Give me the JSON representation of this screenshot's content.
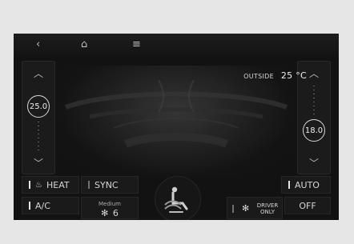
{
  "topbar": {
    "back_icon": "chevron-left-icon",
    "home_icon": "home-icon",
    "menu_icon": "menu-icon"
  },
  "left_zone": {
    "temperature": "25.0"
  },
  "right_zone": {
    "temperature": "18.0"
  },
  "outside": {
    "label": "OUTSIDE",
    "value": "25 °C"
  },
  "buttons": {
    "heat": "HEAT",
    "sync": "SYNC",
    "auto": "AUTO",
    "ac": "A/C",
    "fan_level_label": "Medium",
    "fan_level_value": "6",
    "driver_only_line1": "DRIVER",
    "driver_only_line2": "ONLY",
    "off": "OFF"
  },
  "colors": {
    "screen_bg": "#121212",
    "panel_bg": "#1a1a1a",
    "text": "#d6d6d6"
  }
}
